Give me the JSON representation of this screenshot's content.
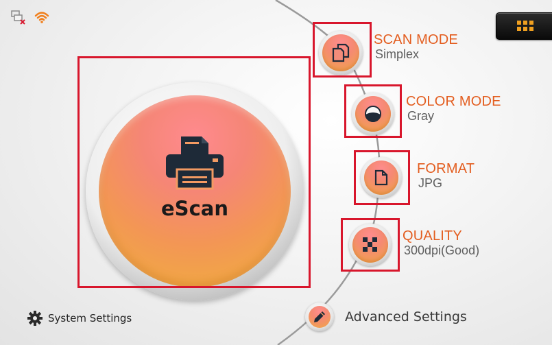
{
  "status_bar": {
    "network_icon": "network-disconnected-icon",
    "wifi_icon": "wifi-icon",
    "wifi_color": "#f0801e"
  },
  "menu": {
    "icon": "grid-icon",
    "icon_color": "#f0a020"
  },
  "main_button": {
    "label": "eScan",
    "icon": "printer-icon"
  },
  "options": [
    {
      "title": "SCAN MODE",
      "value": "Simplex",
      "icon": "duplex-pages-icon"
    },
    {
      "title": "COLOR MODE",
      "value": "Gray",
      "icon": "half-circle-icon"
    },
    {
      "title": "FORMAT",
      "value": "JPG",
      "icon": "page-icon"
    },
    {
      "title": "QUALITY",
      "value": "300dpi(Good)",
      "icon": "checker-icon"
    }
  ],
  "footer": {
    "system_settings_label": "System Settings",
    "system_settings_icon": "gear-icon",
    "advanced_settings_label": "Advanced Settings",
    "advanced_settings_icon": "pen-icon"
  },
  "colors": {
    "accent_title": "#e35d1f",
    "highlight_border": "#d8162c",
    "button_top": "#ff8a8e",
    "button_bottom": "#f0b23b"
  }
}
